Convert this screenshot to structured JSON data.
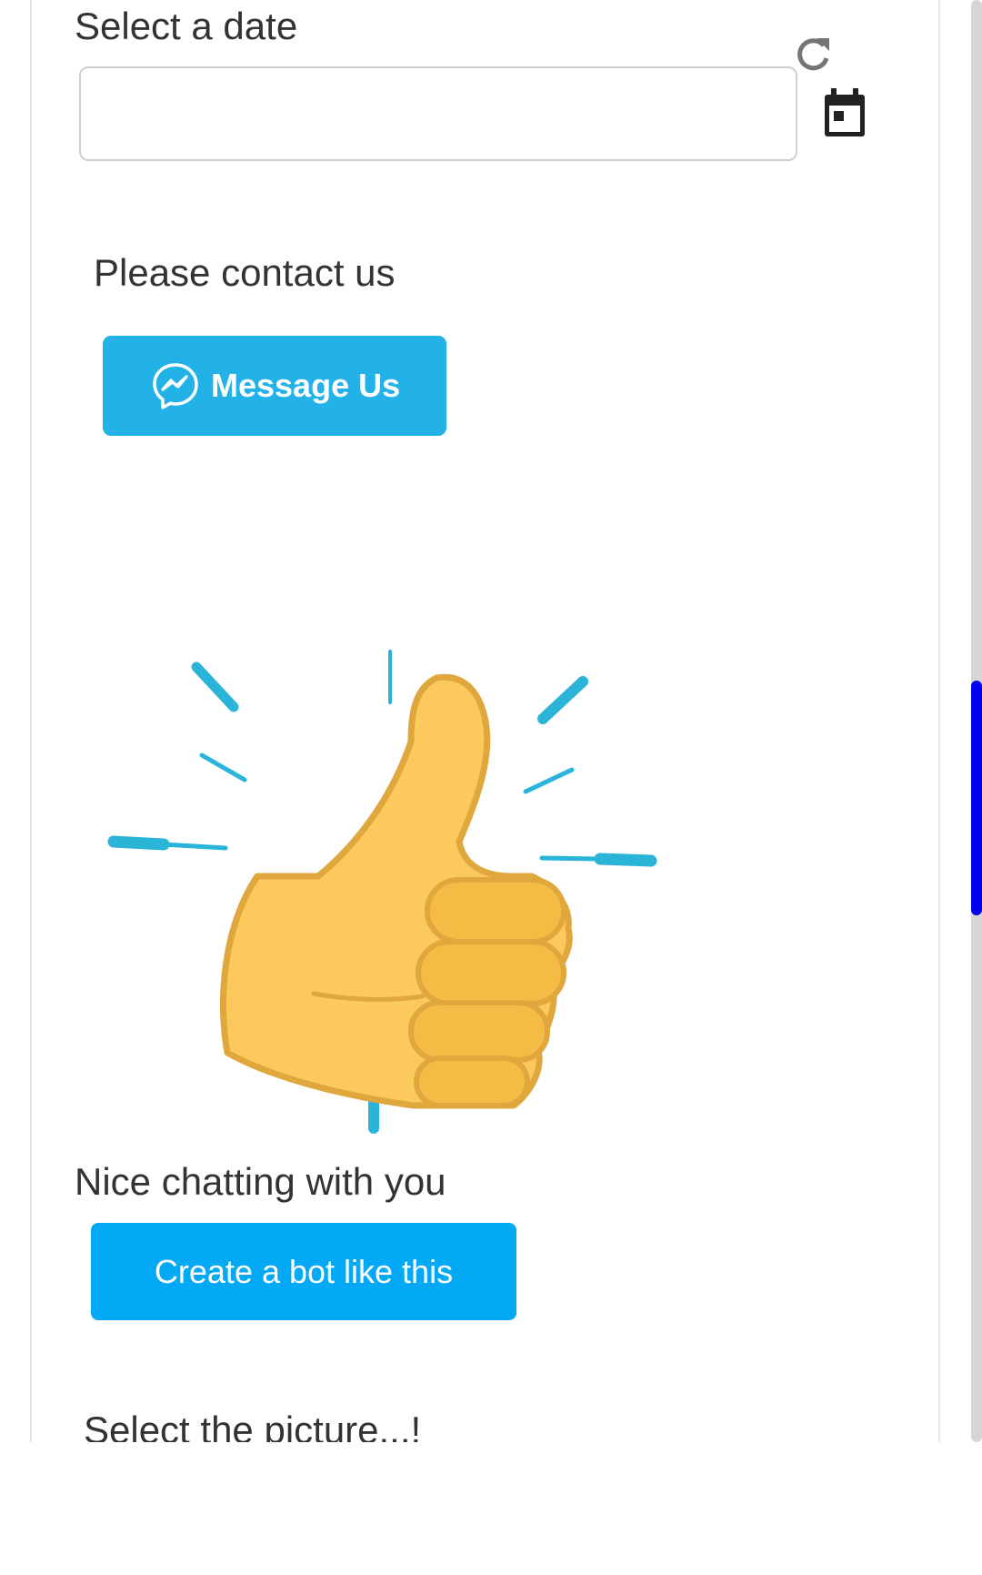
{
  "date_prompt": {
    "label": "Select a date",
    "input_value": "",
    "reset_icon": "refresh-icon",
    "calendar_icon": "calendar-icon"
  },
  "contact": {
    "text": "Please contact us",
    "button_label": "Message Us",
    "button_icon": "messenger-icon",
    "button_color": "#22b2e7"
  },
  "illustration": {
    "icon": "thumbs-up-icon"
  },
  "closing": {
    "text": "Nice chatting with you",
    "button_label": "Create a bot like this",
    "button_color": "#03a9f4"
  },
  "picture_prompt": {
    "text": "Select the picture...!"
  },
  "scrollbar": {
    "thumb_color": "#0000ee"
  }
}
